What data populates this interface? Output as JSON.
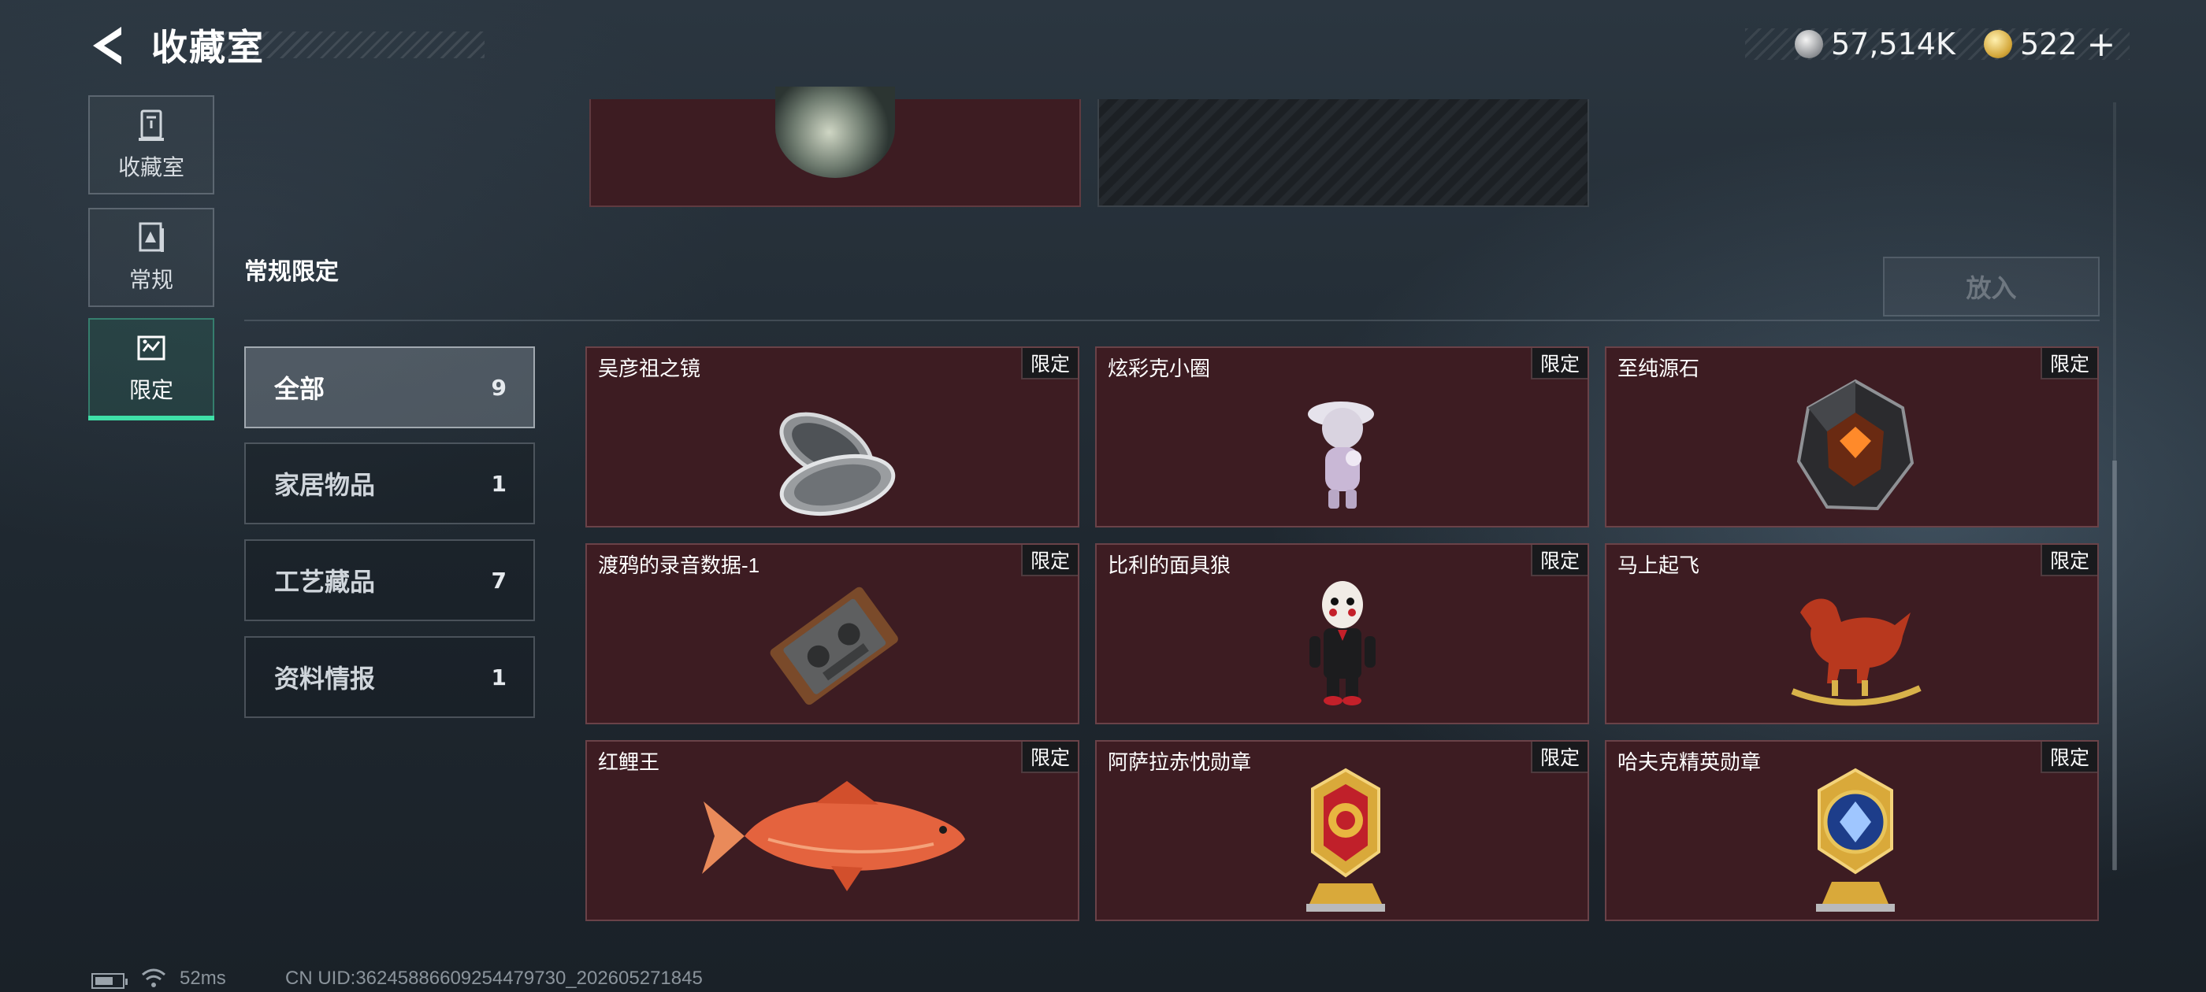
{
  "header": {
    "back_icon": "back-arrow-icon",
    "title": "收藏室",
    "currency_silver": "57,514K",
    "currency_silver_icon": "silver-coin-icon",
    "currency_gold": "522",
    "currency_gold_icon": "gold-coin-icon",
    "add_symbol": "+"
  },
  "nav": [
    {
      "label": "收藏室",
      "icon": "collection-room-icon",
      "selected": false
    },
    {
      "label": "常规",
      "icon": "regular-icon",
      "selected": false
    },
    {
      "label": "限定",
      "icon": "limited-icon",
      "selected": true
    }
  ],
  "section": {
    "title": "常规限定",
    "place_button": "放入"
  },
  "categories": [
    {
      "label": "全部",
      "count": "9",
      "selected": true
    },
    {
      "label": "家居物品",
      "count": "1",
      "selected": false
    },
    {
      "label": "工艺藏品",
      "count": "7",
      "selected": false
    },
    {
      "label": "资料情报",
      "count": "1",
      "selected": false
    }
  ],
  "items": [
    {
      "name": "吴彦祖之镜",
      "tag": "限定",
      "icon": "compact-mirror-icon"
    },
    {
      "name": "炫彩克小圈",
      "tag": "限定",
      "icon": "figurine-icon"
    },
    {
      "name": "至纯源石",
      "tag": "限定",
      "icon": "crystal-stone-icon"
    },
    {
      "name": "渡鸦的录音数据-1",
      "tag": "限定",
      "icon": "cassette-tape-icon"
    },
    {
      "name": "比利的面具狼",
      "tag": "限定",
      "icon": "puppet-figure-icon"
    },
    {
      "name": "马上起飞",
      "tag": "限定",
      "icon": "rocking-horse-icon"
    },
    {
      "name": "红鲤王",
      "tag": "限定",
      "icon": "red-carp-icon"
    },
    {
      "name": "阿萨拉赤忱勋章",
      "tag": "限定",
      "icon": "red-medal-icon"
    },
    {
      "name": "哈夫克精英勋章",
      "tag": "限定",
      "icon": "blue-medal-icon"
    }
  ],
  "status": {
    "ping": "52ms",
    "uid": "CN UID:3624588660925447973​0_202605271845"
  },
  "colors": {
    "card_bg": "#3d1c22",
    "accent": "#3fe0a8"
  }
}
